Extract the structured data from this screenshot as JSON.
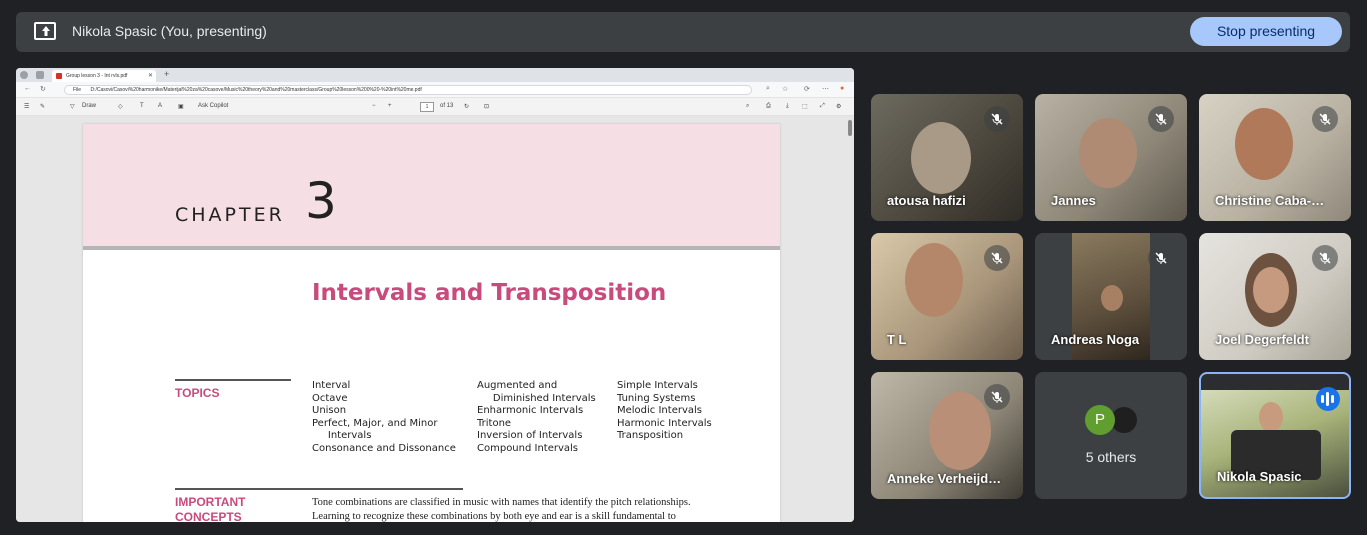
{
  "presenter_bar": {
    "title": "Nikola Spasic (You, presenting)",
    "stop_label": "Stop presenting",
    "icon": "present-screen-icon"
  },
  "shared_screen": {
    "tab_title": "Group lesson 3 - Int rvls.pdf",
    "address_prefix": "File",
    "address": "D:/Casovi/Casovi%20harmonike/Materijal%20za%20casove/Music%20theory%20and%20masterclass/Group%20lesson%200%20-%20int%20me.pdf",
    "toolbar": {
      "draw": "Draw",
      "ask": "Ask Copilot",
      "zoom_minus": "−",
      "zoom_plus": "+",
      "page_current": "1",
      "page_total": "of 13"
    },
    "page": {
      "chapter_word": "CHAPTER",
      "chapter_number": "3",
      "title": "Intervals and Transposition",
      "topics_label": "TOPICS",
      "topics_col1": [
        "Interval",
        "Octave",
        "Unison",
        "Perfect, Major, and Minor",
        "     Intervals",
        "Consonance and Dissonance"
      ],
      "topics_col2": [
        "Augmented and",
        "     Diminished Intervals",
        "Enharmonic Intervals",
        "Tritone",
        "Inversion of Intervals",
        "Compound Intervals"
      ],
      "topics_col3": [
        "Simple Intervals",
        "Tuning Systems",
        "Melodic Intervals",
        "Harmonic Intervals",
        "Transposition"
      ],
      "concepts_label_1": "IMPORTANT",
      "concepts_label_2": "CONCEPTS",
      "body_line_1": "Tone combinations are classified in music with names that identify the pitch relationships.",
      "body_line_2": "Learning to recognize these combinations by both eye and ear is a skill fundamental to"
    }
  },
  "participants": [
    {
      "name": "atousa hafizi",
      "muted": true
    },
    {
      "name": "Jannes",
      "muted": true
    },
    {
      "name": "Christine Caba-…",
      "muted": true
    },
    {
      "name": "T L",
      "muted": true
    },
    {
      "name": "Andreas Noga",
      "muted": true
    },
    {
      "name": "Joel Degerfeldt",
      "muted": true
    },
    {
      "name": "Anneke Verheijd…",
      "muted": true
    },
    {
      "name": "Nikola Spasic",
      "muted": false,
      "speaking": true
    }
  ],
  "others": {
    "label": "5 others",
    "avatar_letter": "P",
    "avatar_color": "#5f9e2f"
  },
  "colors": {
    "accent_pink": "#c94a7d",
    "stop_button": "#a8c7fa",
    "active_border": "#8ab4f8"
  }
}
